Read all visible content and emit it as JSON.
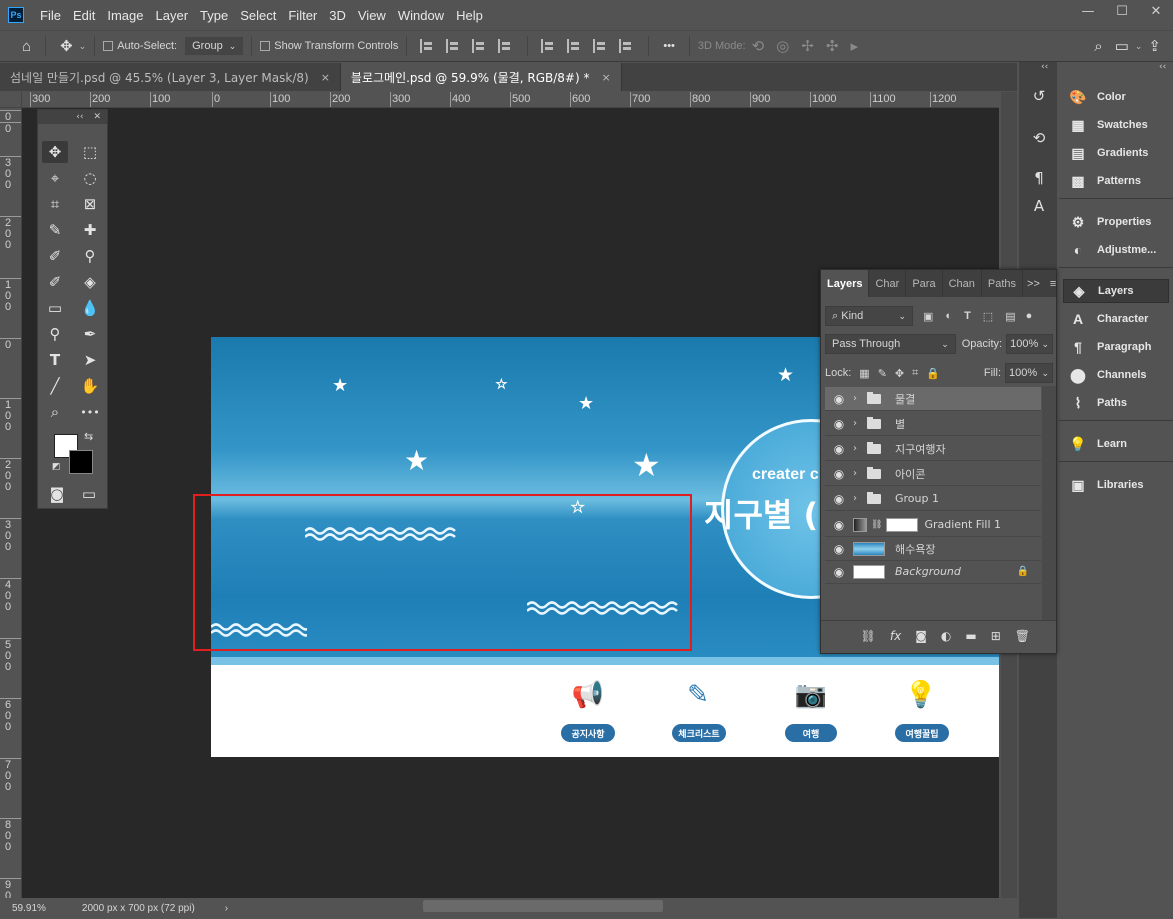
{
  "app": {
    "logo": "Ps"
  },
  "menu": [
    "File",
    "Edit",
    "Image",
    "Layer",
    "Type",
    "Select",
    "Filter",
    "3D",
    "View",
    "Window",
    "Help"
  ],
  "window_buttons": [
    "—",
    "☐",
    "✕"
  ],
  "options": {
    "auto_select_label": "Auto-Select:",
    "auto_select_value": "Group",
    "show_transform_label": "Show Transform Controls",
    "more": "•••",
    "mode_3d": "3D Mode:"
  },
  "tabs": [
    {
      "label": "섬네일 만들기.psd @ 45.5% (Layer 3, Layer Mask/8)",
      "close": "×"
    },
    {
      "label": "블로그메인.psd @ 59.9% (물결, RGB/8#) *",
      "close": "×"
    }
  ],
  "ruler_top": [
    "300",
    "200",
    "100",
    "0",
    "100",
    "200",
    "300",
    "400",
    "500",
    "600",
    "700",
    "800",
    "900",
    "1000",
    "1100",
    "1200"
  ],
  "ruler_left": [
    "0",
    "0",
    "3\n0\n0",
    "2\n0\n0",
    "1\n0\n0",
    "0",
    "1\n0\n0",
    "2\n0\n0",
    "3\n0\n0",
    "4\n0\n0",
    "5\n0\n0",
    "6\n0\n0",
    "7\n0\n0",
    "8\n0\n0",
    "9\n0\n0"
  ],
  "document": {
    "title_en": "creater c",
    "title_ko": "지구별 (",
    "nav": [
      {
        "label": "공지사항",
        "icon": "megaphone-icon",
        "glyph": "📢"
      },
      {
        "label": "체크리스트",
        "icon": "pencil-icon",
        "glyph": "✎"
      },
      {
        "label": "여행",
        "icon": "camera-icon",
        "glyph": "📷"
      },
      {
        "label": "여행꿀팁",
        "icon": "lightbulb-icon",
        "glyph": "💡"
      }
    ]
  },
  "tools_head": [
    "‹‹",
    "✕"
  ],
  "tools": [
    [
      "✥",
      "⬚"
    ],
    [
      "⌖",
      "◌"
    ],
    [
      "⌗",
      "⊠"
    ],
    [
      "✎",
      "✚"
    ],
    [
      "✐",
      "⚲"
    ],
    [
      "✐",
      "◈"
    ],
    [
      "▭",
      "💧"
    ],
    [
      "⚲",
      "✒"
    ],
    [
      "T",
      "➤"
    ],
    [
      "╱",
      "✋"
    ],
    [
      "⌕",
      "•••"
    ]
  ],
  "dock_strip1": [
    "↺",
    "⟲",
    "¶",
    "A"
  ],
  "dock": {
    "groups": [
      [
        {
          "label": "Color",
          "icon": "palette-icon",
          "glyph": "🎨"
        },
        {
          "label": "Swatches",
          "icon": "swatches-icon",
          "glyph": "▦"
        },
        {
          "label": "Gradients",
          "icon": "gradient-icon",
          "glyph": "▤"
        },
        {
          "label": "Patterns",
          "icon": "patterns-icon",
          "glyph": "▩"
        }
      ],
      [
        {
          "label": "Properties",
          "icon": "properties-icon",
          "glyph": "⚙"
        },
        {
          "label": "Adjustme...",
          "icon": "adjustments-icon",
          "glyph": "◐"
        }
      ],
      [
        {
          "label": "Layers",
          "icon": "layers-icon",
          "glyph": "◈"
        },
        {
          "label": "Character",
          "icon": "character-icon",
          "glyph": "A"
        },
        {
          "label": "Paragraph",
          "icon": "paragraph-icon",
          "glyph": "¶"
        },
        {
          "label": "Channels",
          "icon": "channels-icon",
          "glyph": "⬤"
        },
        {
          "label": "Paths",
          "icon": "paths-icon",
          "glyph": "⌇"
        }
      ],
      [
        {
          "label": "Learn",
          "icon": "learn-icon",
          "glyph": "💡"
        }
      ],
      [
        {
          "label": "Libraries",
          "icon": "libraries-icon",
          "glyph": "▣"
        }
      ]
    ]
  },
  "layers_panel": {
    "tabs": [
      "Layers",
      "Char",
      "Para",
      "Chan",
      "Paths"
    ],
    "more": ">>",
    "kind": "Kind",
    "blend": "Pass Through",
    "opacity_label": "Opacity:",
    "opacity": "100%",
    "lock_label": "Lock:",
    "fill_label": "Fill:",
    "fill": "100%",
    "layers": [
      {
        "name": "물결",
        "type": "group",
        "selected": true
      },
      {
        "name": "별",
        "type": "group"
      },
      {
        "name": "지구여행자",
        "type": "group"
      },
      {
        "name": "아이콘",
        "type": "group"
      },
      {
        "name": "Group 1",
        "type": "group"
      },
      {
        "name": "Gradient Fill 1",
        "type": "fill"
      },
      {
        "name": "해수욕장",
        "type": "image"
      },
      {
        "name": "Background",
        "type": "background"
      }
    ],
    "bottom": [
      "⛓",
      "fx",
      "◙",
      "◐",
      "▬",
      "⊞",
      "🗑"
    ]
  },
  "status": {
    "zoom": "59.91%",
    "size": "2000 px x 700 px (72 ppi)",
    "arrow": "›"
  },
  "colors": {
    "accent": "#31a8ff",
    "selection": "#e21d1d",
    "sky": "#1a79ad",
    "nav_pill": "#2a6ea6"
  }
}
